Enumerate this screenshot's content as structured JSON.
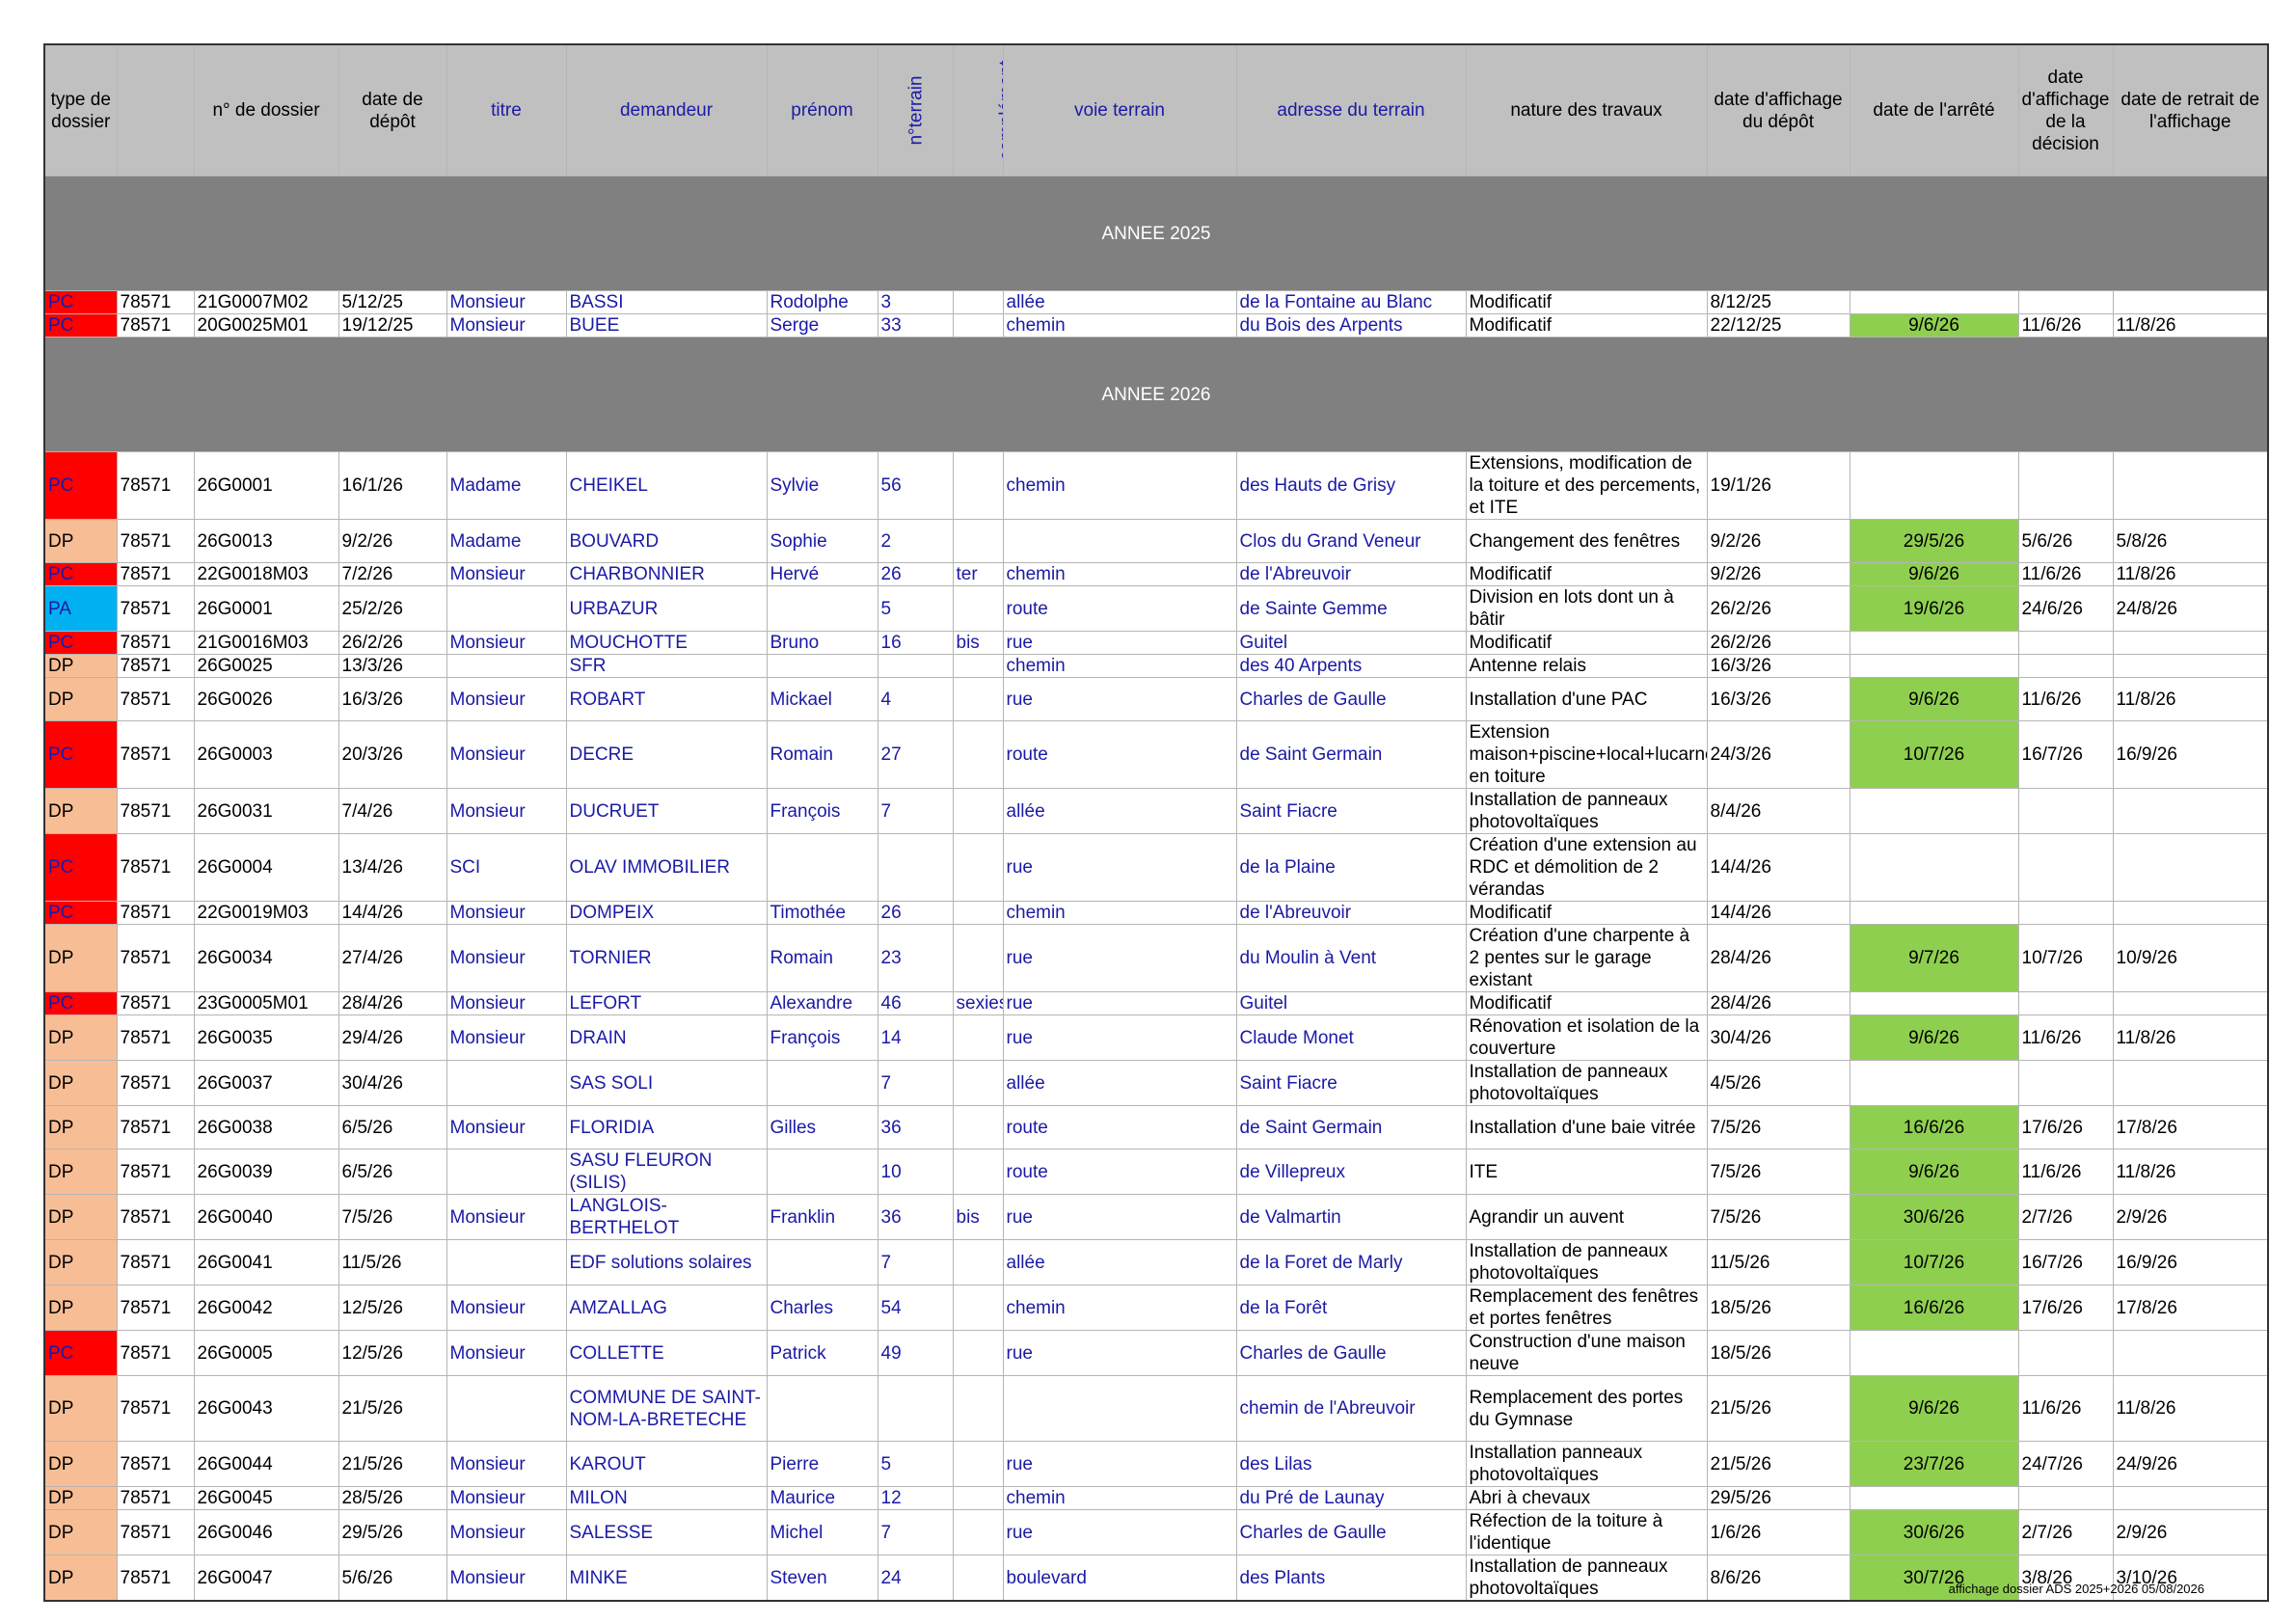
{
  "headers": [
    "type de dossier",
    "",
    "n° de dossier",
    "date de dépôt",
    "titre",
    "demandeur",
    "prénom",
    "n°terrain",
    "complément",
    "voie terrain",
    "adresse du terrain",
    "nature des travaux",
    "date d'affichage du dépôt",
    "date de l'arrêté",
    "date d'affichage de la décision",
    "date de retrait de l'affichage"
  ],
  "sections": [
    {
      "title": "ANNEE 2025",
      "rows": [
        {
          "type": "PC",
          "code": "78571",
          "dossier": "21G0007M02",
          "depot": "5/12/25",
          "titre": "Monsieur",
          "demandeur": "BASSI",
          "prenom": "Rodolphe",
          "num": "3",
          "comp": "",
          "voie": "allée",
          "adresse": "de la Fontaine au Blanc",
          "nature": "Modificatif",
          "aff_depot": "8/12/25",
          "arrete": "",
          "aff_decision": "",
          "retrait": ""
        },
        {
          "type": "PC",
          "code": "78571",
          "dossier": "20G0025M01",
          "depot": "19/12/25",
          "titre": "Monsieur",
          "demandeur": "BUEE",
          "prenom": "Serge",
          "num": "33",
          "comp": "",
          "voie": "chemin",
          "adresse": "du Bois des Arpents",
          "nature": "Modificatif",
          "aff_depot": "22/12/25",
          "arrete": "9/6/26",
          "aff_decision": "11/6/26",
          "retrait": "11/8/26"
        }
      ]
    },
    {
      "title": "ANNEE 2026",
      "rows": [
        {
          "type": "PC",
          "code": "78571",
          "dossier": "26G0001",
          "depot": "16/1/26",
          "titre": "Madame",
          "demandeur": "CHEIKEL",
          "prenom": "Sylvie",
          "num": "56",
          "comp": "",
          "voie": "chemin",
          "adresse": "des Hauts de Grisy",
          "nature": "Extensions, modification de la toiture et des percements, et ITE",
          "aff_depot": "19/1/26",
          "arrete": "",
          "aff_decision": "",
          "retrait": ""
        },
        {
          "type": "DP",
          "code": "78571",
          "dossier": "26G0013",
          "depot": "9/2/26",
          "titre": "Madame",
          "demandeur": "BOUVARD",
          "prenom": "Sophie",
          "num": "2",
          "comp": "",
          "voie": "",
          "adresse": "Clos du Grand Veneur",
          "nature": "Changement des fenêtres",
          "aff_depot": "9/2/26",
          "arrete": "29/5/26",
          "aff_decision": "5/6/26",
          "retrait": "5/8/26"
        },
        {
          "type": "PC",
          "code": "78571",
          "dossier": "22G0018M03",
          "depot": "7/2/26",
          "titre": "Monsieur",
          "demandeur": "CHARBONNIER",
          "prenom": "Hervé",
          "num": "26",
          "comp": "ter",
          "voie": "chemin",
          "adresse": "de l'Abreuvoir",
          "nature": "Modificatif",
          "aff_depot": "9/2/26",
          "arrete": "9/6/26",
          "aff_decision": "11/6/26",
          "retrait": "11/8/26"
        },
        {
          "type": "PA",
          "code": "78571",
          "dossier": "26G0001",
          "depot": "25/2/26",
          "titre": "",
          "demandeur": "URBAZUR",
          "prenom": "",
          "num": "5",
          "comp": "",
          "voie": "route",
          "adresse": "de Sainte Gemme",
          "nature": "Division en lots dont un à bâtir",
          "aff_depot": "26/2/26",
          "arrete": "19/6/26",
          "aff_decision": "24/6/26",
          "retrait": "24/8/26"
        },
        {
          "type": "PC",
          "code": "78571",
          "dossier": "21G0016M03",
          "depot": "26/2/26",
          "titre": "Monsieur",
          "demandeur": "MOUCHOTTE",
          "prenom": "Bruno",
          "num": "16",
          "comp": "bis",
          "voie": "rue",
          "adresse": "Guitel",
          "nature": "Modificatif",
          "aff_depot": "26/2/26",
          "arrete": "",
          "aff_decision": "",
          "retrait": ""
        },
        {
          "type": "DP",
          "code": "78571",
          "dossier": "26G0025",
          "depot": "13/3/26",
          "titre": "",
          "demandeur": "SFR",
          "prenom": "",
          "num": "",
          "comp": "",
          "voie": "chemin",
          "adresse": "des 40 Arpents",
          "nature": "Antenne relais",
          "aff_depot": "16/3/26",
          "arrete": "",
          "aff_decision": "",
          "retrait": ""
        },
        {
          "type": "DP",
          "code": "78571",
          "dossier": "26G0026",
          "depot": "16/3/26",
          "titre": "Monsieur",
          "demandeur": "ROBART",
          "prenom": "Mickael",
          "num": "4",
          "comp": "",
          "voie": "rue",
          "adresse": "Charles de Gaulle",
          "nature": "Installation d'une PAC",
          "aff_depot": "16/3/26",
          "arrete": "9/6/26",
          "aff_decision": "11/6/26",
          "retrait": "11/8/26"
        },
        {
          "type": "PC",
          "code": "78571",
          "dossier": "26G0003",
          "depot": "20/3/26",
          "titre": "Monsieur",
          "demandeur": "DECRE",
          "prenom": "Romain",
          "num": "27",
          "comp": "",
          "voie": "route",
          "adresse": "de Saint Germain",
          "nature": "Extension maison+piscine+local+lucarnes en toiture",
          "aff_depot": "24/3/26",
          "arrete": "10/7/26",
          "aff_decision": "16/7/26",
          "retrait": "16/9/26"
        },
        {
          "type": "DP",
          "code": "78571",
          "dossier": "26G0031",
          "depot": "7/4/26",
          "titre": "Monsieur",
          "demandeur": "DUCRUET",
          "prenom": "François",
          "num": "7",
          "comp": "",
          "voie": "allée",
          "adresse": "Saint Fiacre",
          "nature": "Installation de panneaux photovoltaïques",
          "aff_depot": "8/4/26",
          "arrete": "",
          "aff_decision": "",
          "retrait": ""
        },
        {
          "type": "PC",
          "code": "78571",
          "dossier": "26G0004",
          "depot": "13/4/26",
          "titre": "SCI",
          "demandeur": "OLAV IMMOBILIER",
          "prenom": "",
          "num": "",
          "comp": "",
          "voie": "rue",
          "adresse": "de la Plaine",
          "nature": "Création d'une extension au RDC et démolition de 2 vérandas",
          "aff_depot": "14/4/26",
          "arrete": "",
          "aff_decision": "",
          "retrait": ""
        },
        {
          "type": "PC",
          "code": "78571",
          "dossier": "22G0019M03",
          "depot": "14/4/26",
          "titre": "Monsieur",
          "demandeur": "DOMPEIX",
          "prenom": "Timothée",
          "num": "26",
          "comp": "",
          "voie": "chemin",
          "adresse": "de l'Abreuvoir",
          "nature": "Modificatif",
          "aff_depot": "14/4/26",
          "arrete": "",
          "aff_decision": "",
          "retrait": ""
        },
        {
          "type": "DP",
          "code": "78571",
          "dossier": "26G0034",
          "depot": "27/4/26",
          "titre": "Monsieur",
          "demandeur": "TORNIER",
          "prenom": "Romain",
          "num": "23",
          "comp": "",
          "voie": "rue",
          "adresse": "du Moulin à Vent",
          "nature": "Création d'une charpente à 2 pentes sur le garage existant",
          "aff_depot": "28/4/26",
          "arrete": "9/7/26",
          "aff_decision": "10/7/26",
          "retrait": "10/9/26"
        },
        {
          "type": "PC",
          "code": "78571",
          "dossier": "23G0005M01",
          "depot": "28/4/26",
          "titre": "Monsieur",
          "demandeur": "LEFORT",
          "prenom": "Alexandre",
          "num": "46",
          "comp": "sexies",
          "voie": "rue",
          "adresse": "Guitel",
          "nature": "Modificatif",
          "aff_depot": "28/4/26",
          "arrete": "",
          "aff_decision": "",
          "retrait": ""
        },
        {
          "type": "DP",
          "code": "78571",
          "dossier": "26G0035",
          "depot": "29/4/26",
          "titre": "Monsieur",
          "demandeur": "DRAIN",
          "prenom": "François",
          "num": "14",
          "comp": "",
          "voie": "rue",
          "adresse": "Claude Monet",
          "nature": "Rénovation et isolation de la couverture",
          "aff_depot": "30/4/26",
          "arrete": "9/6/26",
          "aff_decision": "11/6/26",
          "retrait": "11/8/26"
        },
        {
          "type": "DP",
          "code": "78571",
          "dossier": "26G0037",
          "depot": "30/4/26",
          "titre": "",
          "demandeur": "SAS SOLI",
          "prenom": "",
          "num": "7",
          "comp": "",
          "voie": "allée",
          "adresse": "Saint Fiacre",
          "nature": "Installation de panneaux photovoltaïques",
          "aff_depot": "4/5/26",
          "arrete": "",
          "aff_decision": "",
          "retrait": ""
        },
        {
          "type": "DP",
          "code": "78571",
          "dossier": "26G0038",
          "depot": "6/5/26",
          "titre": "Monsieur",
          "demandeur": "FLORIDIA",
          "prenom": "Gilles",
          "num": "36",
          "comp": "",
          "voie": "route",
          "adresse": "de Saint Germain",
          "nature": "Installation d'une baie vitrée",
          "aff_depot": "7/5/26",
          "arrete": "16/6/26",
          "aff_decision": "17/6/26",
          "retrait": "17/8/26"
        },
        {
          "type": "DP",
          "code": "78571",
          "dossier": "26G0039",
          "depot": "6/5/26",
          "titre": "",
          "demandeur": "SASU FLEURON (SILIS)",
          "prenom": "",
          "num": "10",
          "comp": "",
          "voie": "route",
          "adresse": "de Villepreux",
          "nature": "ITE",
          "aff_depot": "7/5/26",
          "arrete": "9/6/26",
          "aff_decision": "11/6/26",
          "retrait": "11/8/26"
        },
        {
          "type": "DP",
          "code": "78571",
          "dossier": "26G0040",
          "depot": "7/5/26",
          "titre": "Monsieur",
          "demandeur": "LANGLOIS-BERTHELOT",
          "prenom": "Franklin",
          "num": "36",
          "comp": "bis",
          "voie": "rue",
          "adresse": "de Valmartin",
          "nature": "Agrandir un auvent",
          "aff_depot": "7/5/26",
          "arrete": "30/6/26",
          "aff_decision": "2/7/26",
          "retrait": "2/9/26"
        },
        {
          "type": "DP",
          "code": "78571",
          "dossier": "26G0041",
          "depot": "11/5/26",
          "titre": "",
          "demandeur": "EDF solutions solaires",
          "prenom": "",
          "num": "7",
          "comp": "",
          "voie": "allée",
          "adresse": "de la Foret de Marly",
          "nature": "Installation de panneaux photovoltaïques",
          "aff_depot": "11/5/26",
          "arrete": "10/7/26",
          "aff_decision": "16/7/26",
          "retrait": "16/9/26"
        },
        {
          "type": "DP",
          "code": "78571",
          "dossier": "26G0042",
          "depot": "12/5/26",
          "titre": "Monsieur",
          "demandeur": "AMZALLAG",
          "prenom": "Charles",
          "num": "54",
          "comp": "",
          "voie": "chemin",
          "adresse": "de la Forêt",
          "nature": "Remplacement des fenêtres et portes fenêtres",
          "aff_depot": "18/5/26",
          "arrete": "16/6/26",
          "aff_decision": "17/6/26",
          "retrait": "17/8/26"
        },
        {
          "type": "PC",
          "code": "78571",
          "dossier": "26G0005",
          "depot": "12/5/26",
          "titre": "Monsieur",
          "demandeur": "COLLETTE",
          "prenom": "Patrick",
          "num": "49",
          "comp": "",
          "voie": "rue",
          "adresse": "Charles de Gaulle",
          "nature": "Construction d'une maison neuve",
          "aff_depot": "18/5/26",
          "arrete": "",
          "aff_decision": "",
          "retrait": ""
        },
        {
          "type": "DP",
          "code": "78571",
          "dossier": "26G0043",
          "depot": "21/5/26",
          "titre": "",
          "demandeur": "COMMUNE DE SAINT-NOM-LA-BRETECHE",
          "prenom": "",
          "num": "",
          "comp": "",
          "voie": "",
          "adresse": "chemin de l'Abreuvoir",
          "nature": "Remplacement des portes du Gymnase",
          "aff_depot": "21/5/26",
          "arrete": "9/6/26",
          "aff_decision": "11/6/26",
          "retrait": "11/8/26"
        },
        {
          "type": "DP",
          "code": "78571",
          "dossier": "26G0044",
          "depot": "21/5/26",
          "titre": "Monsieur",
          "demandeur": "KAROUT",
          "prenom": "Pierre",
          "num": "5",
          "comp": "",
          "voie": "rue",
          "adresse": "des Lilas",
          "nature": "Installation panneaux photovoltaïques",
          "aff_depot": "21/5/26",
          "arrete": "23/7/26",
          "aff_decision": "24/7/26",
          "retrait": "24/9/26"
        },
        {
          "type": "DP",
          "code": "78571",
          "dossier": "26G0045",
          "depot": "28/5/26",
          "titre": "Monsieur",
          "demandeur": "MILON",
          "prenom": "Maurice",
          "num": "12",
          "comp": "",
          "voie": "chemin",
          "adresse": "du Pré de Launay",
          "nature": "Abri à chevaux",
          "aff_depot": "29/5/26",
          "arrete": "",
          "aff_decision": "",
          "retrait": ""
        },
        {
          "type": "DP",
          "code": "78571",
          "dossier": "26G0046",
          "depot": "29/5/26",
          "titre": "Monsieur",
          "demandeur": "SALESSE",
          "prenom": "Michel",
          "num": "7",
          "comp": "",
          "voie": "rue",
          "adresse": "Charles de Gaulle",
          "nature": "Réfection de la toiture à l'identique",
          "aff_depot": "1/6/26",
          "arrete": "30/6/26",
          "aff_decision": "2/7/26",
          "retrait": "2/9/26"
        },
        {
          "type": "DP",
          "code": "78571",
          "dossier": "26G0047",
          "depot": "5/6/26",
          "titre": "Monsieur",
          "demandeur": "MINKE",
          "prenom": "Steven",
          "num": "24",
          "comp": "",
          "voie": "boulevard",
          "adresse": "des Plants",
          "nature": "Installation de panneaux photovoltaïques",
          "aff_depot": "8/6/26",
          "arrete": "30/7/26",
          "aff_decision": "3/8/26",
          "retrait": "3/10/26"
        }
      ]
    }
  ],
  "footer": "affichage dossier ADS 2025+2026 05/08/2026",
  "colors": {
    "PC": "#ff0000",
    "DP": "#f7be95",
    "PA": "#00b0f0",
    "arrete": "#8fcf4f",
    "year_band": "#808080",
    "header": "#c0c0c0",
    "blue_text": "#1a1aa6"
  }
}
